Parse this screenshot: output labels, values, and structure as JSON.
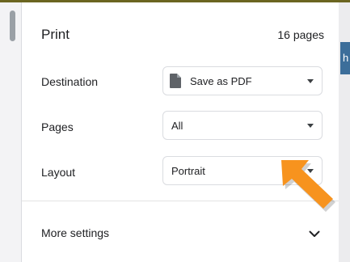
{
  "dialog": {
    "title": "Print",
    "page_count": "16 pages"
  },
  "rows": {
    "destination": {
      "label": "Destination",
      "value": "Save as PDF",
      "icon": "file-icon"
    },
    "pages": {
      "label": "Pages",
      "value": "All"
    },
    "layout": {
      "label": "Layout",
      "value": "Portrait"
    }
  },
  "more_settings": {
    "label": "More settings",
    "icon": "chevron-down-icon"
  },
  "edge_tab": {
    "text": "h"
  },
  "colors": {
    "accent_arrow": "#f7931e",
    "page_bg": "#e7e7e9",
    "edge_tab": "#3c6e9a"
  }
}
